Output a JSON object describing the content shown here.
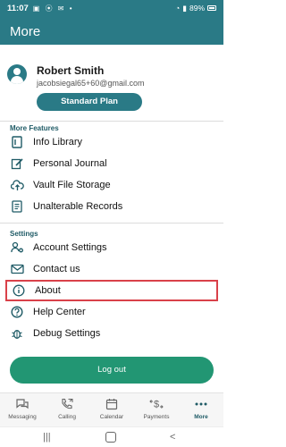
{
  "status_bar": {
    "time": "11:07",
    "battery": "89%"
  },
  "header": {
    "title": "More"
  },
  "profile": {
    "name": "Robert Smith",
    "email": "jacobsiegal65+60@gmail.com",
    "plan_label": "Standard Plan"
  },
  "sections": [
    {
      "title": "More Features",
      "items": [
        {
          "label": "Info Library",
          "icon": "info-library-icon"
        },
        {
          "label": "Personal Journal",
          "icon": "edit-icon"
        },
        {
          "label": "Vault File Storage",
          "icon": "cloud-upload-icon"
        },
        {
          "label": "Unalterable Records",
          "icon": "records-icon"
        }
      ]
    },
    {
      "title": "Settings",
      "items": [
        {
          "label": "Account Settings",
          "icon": "account-settings-icon"
        },
        {
          "label": "Contact us",
          "icon": "mail-icon"
        },
        {
          "label": "About",
          "icon": "info-icon"
        },
        {
          "label": "Help Center",
          "icon": "help-icon"
        },
        {
          "label": "Debug Settings",
          "icon": "bug-icon"
        }
      ]
    }
  ],
  "logout_label": "Log out",
  "bottom_nav": [
    {
      "label": "Messaging",
      "icon": "chat-icon"
    },
    {
      "label": "Calling",
      "icon": "phone-icon"
    },
    {
      "label": "Calendar",
      "icon": "calendar-icon"
    },
    {
      "label": "Payments",
      "icon": "payments-icon"
    },
    {
      "label": "More",
      "icon": "more-icon",
      "active": true
    }
  ],
  "colors": {
    "primary": "#2a7a86",
    "logout": "#229673",
    "highlight": "#d9414a"
  }
}
